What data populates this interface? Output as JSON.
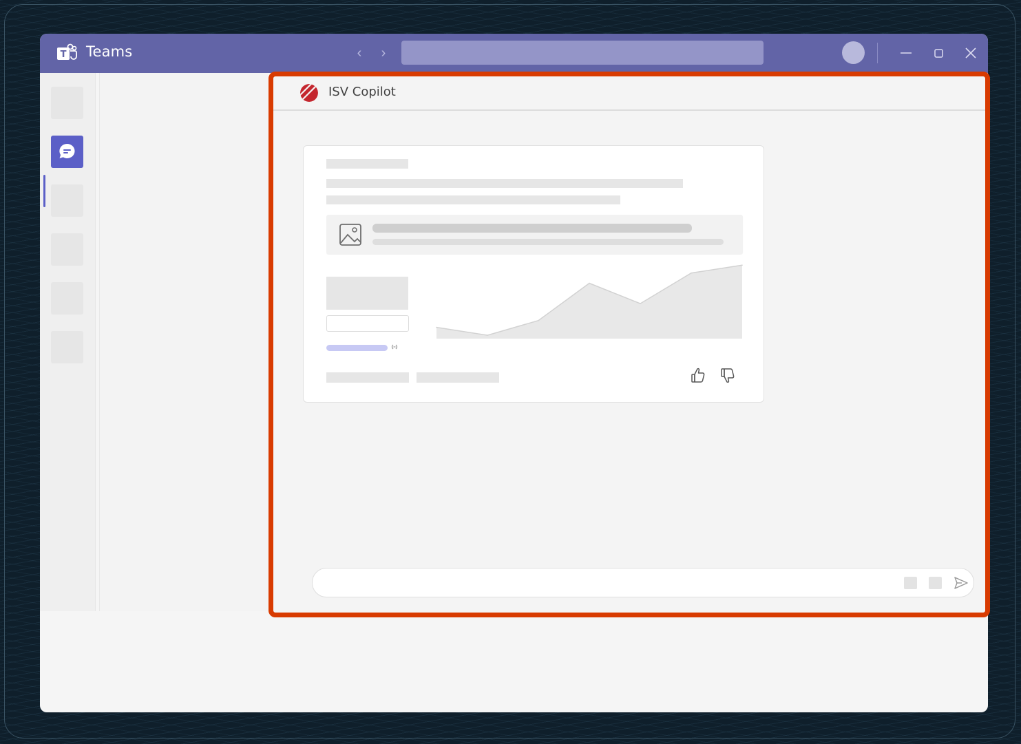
{
  "window": {
    "app_title": "Teams",
    "brand_color": "#6264a7",
    "icons": {
      "logo": "teams-logo-icon",
      "back": "chevron-left-icon",
      "forward": "chevron-right-icon",
      "minimize": "minimize-icon",
      "maximize": "maximize-icon",
      "close": "close-icon"
    },
    "back_glyph": "‹",
    "forward_glyph": "›",
    "search_placeholder": ""
  },
  "rail": {
    "active_item": "chat",
    "items": [
      "placeholder",
      "chat",
      "placeholder",
      "placeholder",
      "placeholder",
      "placeholder"
    ],
    "active_color": "#5b5fc7"
  },
  "copilot": {
    "title": "ISV Copilot",
    "highlight_color": "#d83b01",
    "logo_icon": "isv-copilot-logo-icon",
    "card": {
      "icons": [
        "image-icon",
        "link-icon",
        "thumbs-up-icon",
        "thumbs-down-icon"
      ],
      "chart_data": {
        "type": "area",
        "title": "",
        "x": [
          0,
          1,
          2,
          3,
          4,
          5,
          6
        ],
        "values": [
          20,
          6,
          32,
          98,
          62,
          116,
          130
        ],
        "ylim": [
          0,
          140
        ],
        "grid": false
      }
    },
    "compose": {
      "placeholder": "",
      "send_icon": "send-icon"
    }
  }
}
